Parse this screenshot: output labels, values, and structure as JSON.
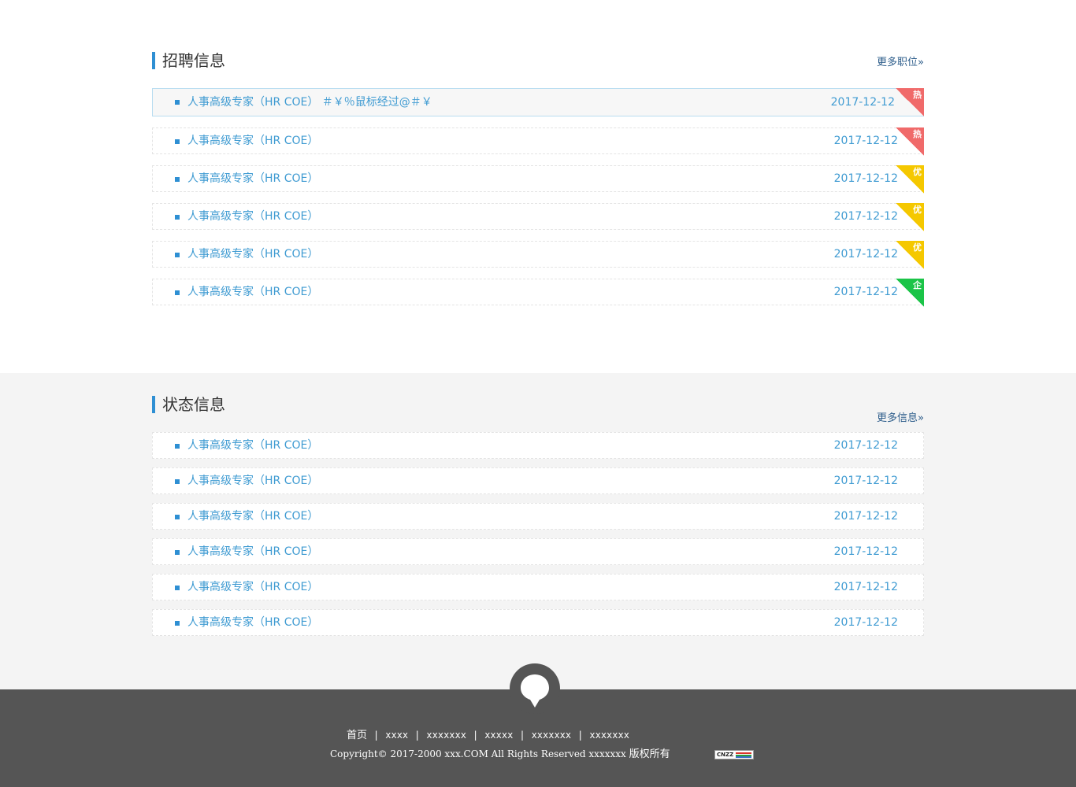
{
  "jobs": {
    "title": "招聘信息",
    "more": "更多职位»",
    "items": [
      {
        "title": "人事高级专家（HR COE） ＃￥％鼠标经过@＃￥",
        "date": "2017-12-12",
        "tag": "热",
        "tag_color": "#f06a6a"
      },
      {
        "title": "人事高级专家（HR COE）",
        "date": "2017-12-12",
        "tag": "热",
        "tag_color": "#f06a6a"
      },
      {
        "title": "人事高级专家（HR COE）",
        "date": "2017-12-12",
        "tag": "优",
        "tag_color": "#f5c800"
      },
      {
        "title": "人事高级专家（HR COE）",
        "date": "2017-12-12",
        "tag": "优",
        "tag_color": "#f5c800"
      },
      {
        "title": "人事高级专家（HR COE）",
        "date": "2017-12-12",
        "tag": "优",
        "tag_color": "#f5c800"
      },
      {
        "title": "人事高级专家（HR COE）",
        "date": "2017-12-12",
        "tag": "企",
        "tag_color": "#1bc448"
      }
    ]
  },
  "status": {
    "title": "状态信息",
    "more": "更多信息»",
    "items": [
      {
        "title": "人事高级专家（HR COE）",
        "date": "2017-12-12"
      },
      {
        "title": "人事高级专家（HR COE）",
        "date": "2017-12-12"
      },
      {
        "title": "人事高级专家（HR COE）",
        "date": "2017-12-12"
      },
      {
        "title": "人事高级专家（HR COE）",
        "date": "2017-12-12"
      },
      {
        "title": "人事高级专家（HR COE）",
        "date": "2017-12-12"
      },
      {
        "title": "人事高级专家（HR COE）",
        "date": "2017-12-12"
      }
    ]
  },
  "footer": {
    "icon": "map-pin-icon",
    "nav": [
      "首页",
      "xxxx",
      "xxxxxxx",
      "xxxxx",
      "xxxxxxx",
      "xxxxxxx"
    ],
    "copyright_prefix": "Copyright© 2017-2000 xxx.COM All Rights Reserved xxxxxxx",
    "copyright_suffix": "版权所有",
    "cnzz_label": "CNZZ"
  }
}
